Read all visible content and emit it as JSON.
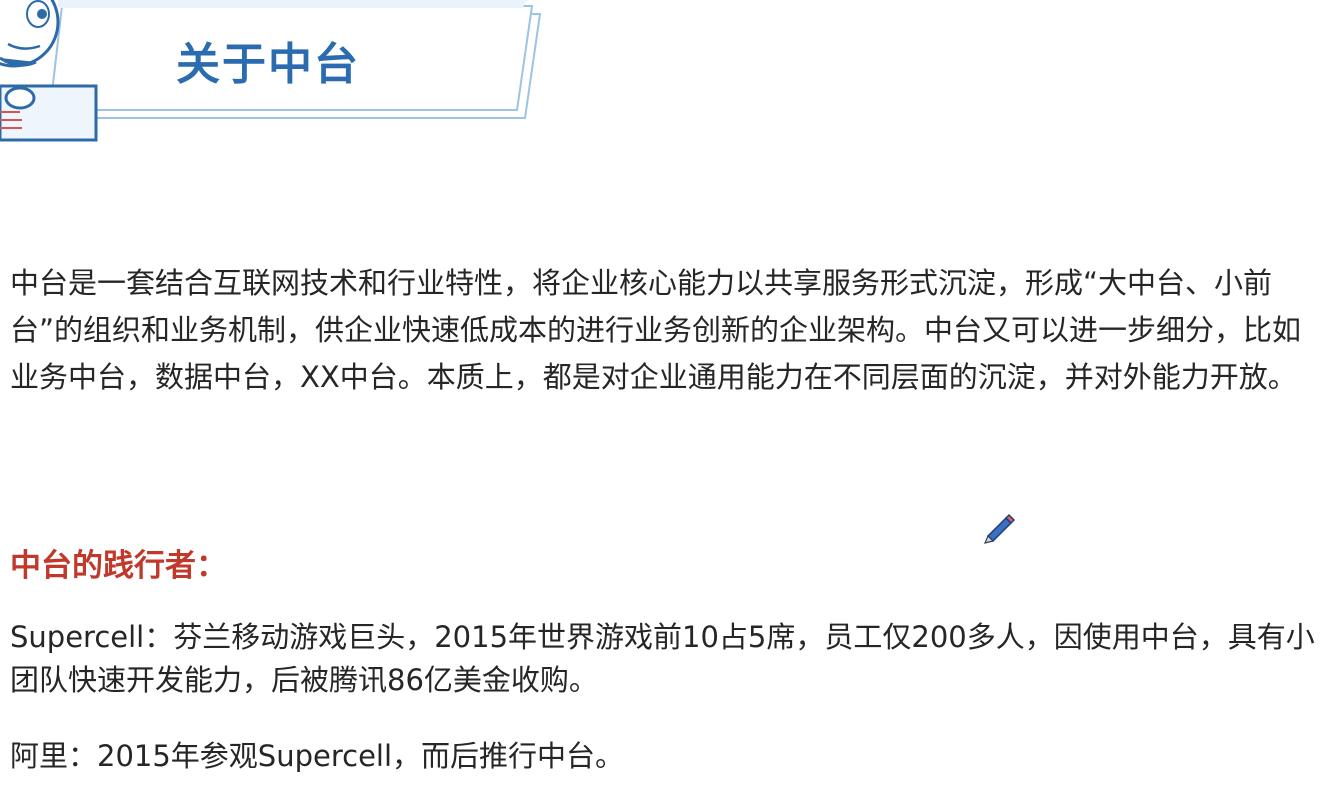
{
  "header": {
    "title": "关于中台",
    "mascot_icon": "cat-mascot-icon",
    "accent_color": "#2b6cb0"
  },
  "intro": {
    "text": "中台是一套结合互联网技术和行业特性，将企业核心能力以共享服务形式沉淀，形成“大中台、小前台”的组织和业务机制，供企业快速低成本的进行业务创新的企业架构。中台又可以进一步细分，比如业务中台，数据中台，XX中台。本质上，都是对企业通用能力在不同层面的沉淀，并对外能力开放。"
  },
  "practitioners": {
    "heading": "中台的践行者：",
    "heading_color": "#c0392b",
    "supercell": "Supercell：芬兰移动游戏巨头，2015年世界游戏前10占5席，员工仅200多人，因使用中台，具有小团队快速开发能力，后被腾讯86亿美金收购。",
    "ali": "阿里：2015年参观Supercell，而后推行中台。"
  },
  "cursor": {
    "icon": "pencil-cursor-icon"
  }
}
